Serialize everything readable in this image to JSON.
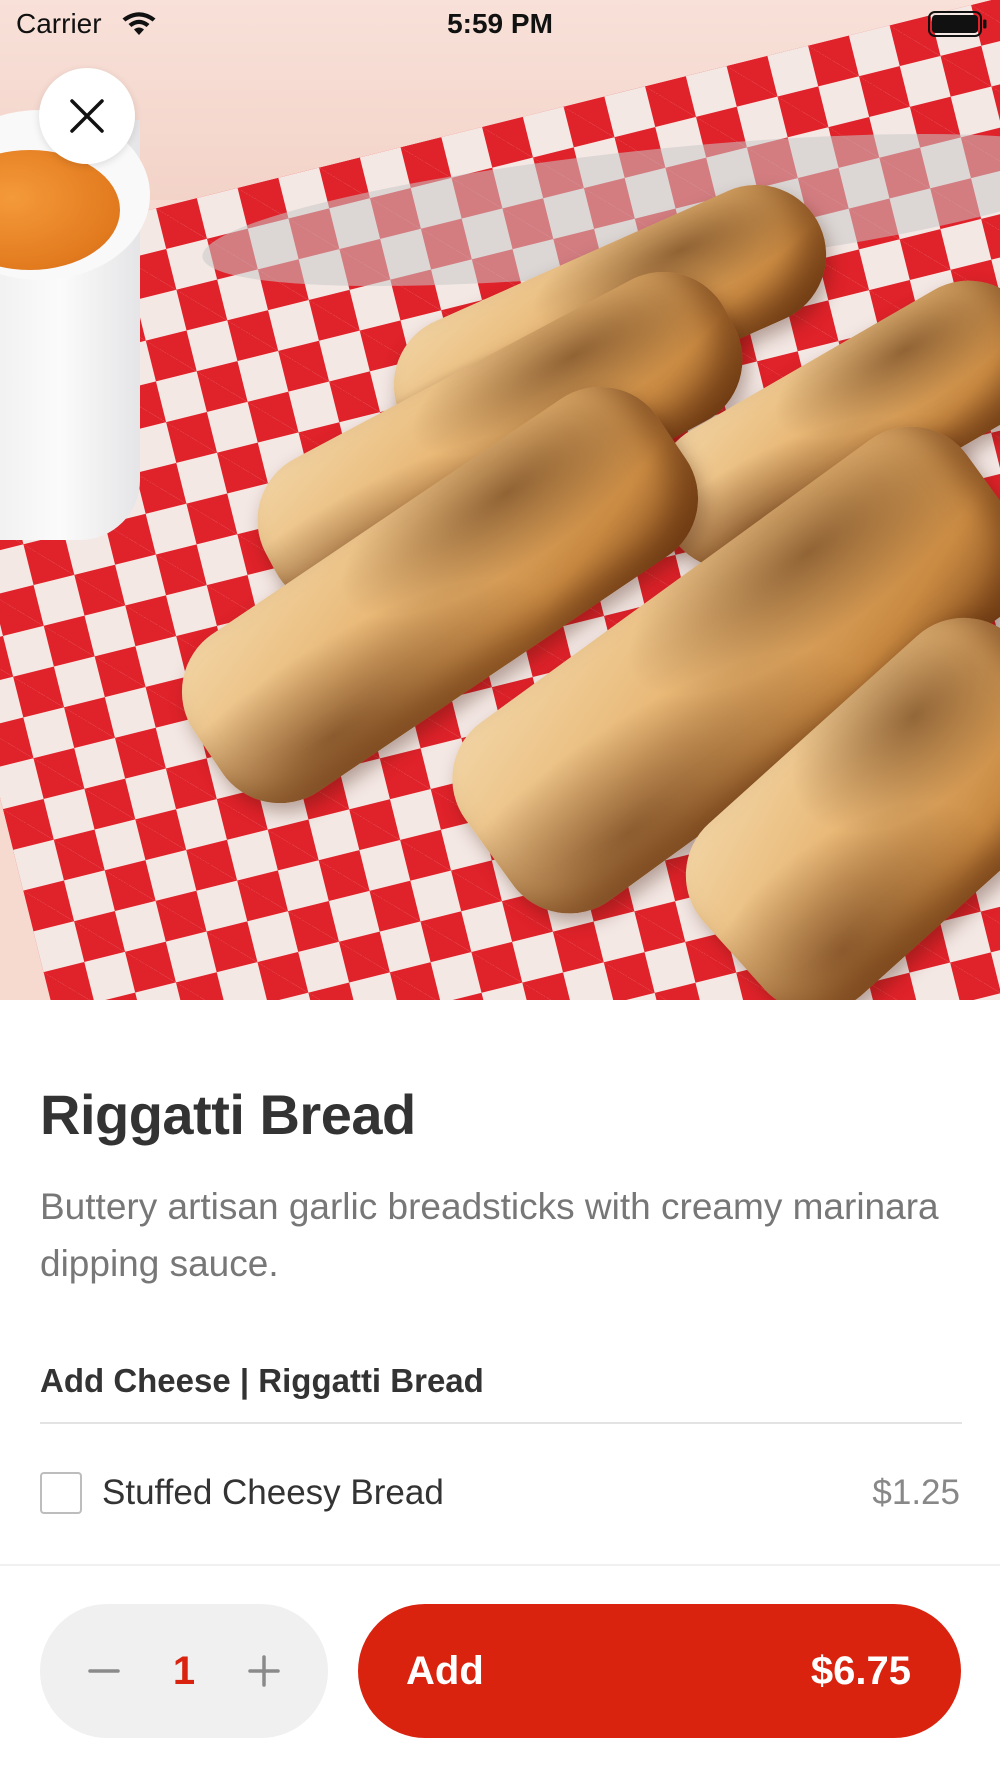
{
  "status_bar": {
    "carrier": "Carrier",
    "time": "5:59 PM",
    "icons": [
      "wifi-icon",
      "battery-icon"
    ]
  },
  "hero": {
    "image_subject": "breadsticks with marinara dipping sauce on red checkered paper"
  },
  "close_button": {
    "icon": "close-icon"
  },
  "item": {
    "title": "Riggatti Bread",
    "description": "Buttery artisan garlic breadsticks with creamy marinara dipping sauce."
  },
  "options_section": {
    "header": "Add Cheese | Riggatti Bread",
    "options": [
      {
        "label": "Stuffed Cheesy Bread",
        "price": "$1.25",
        "checked": false
      }
    ]
  },
  "bottom_bar": {
    "quantity": "1",
    "minus_icon": "minus-icon",
    "plus_icon": "plus-icon",
    "add_label": "Add",
    "add_price": "$6.75"
  },
  "colors": {
    "accent": "#d9230f",
    "title_text": "#333333",
    "secondary_text": "#777777",
    "stepper_background": "#f0f0f0"
  }
}
